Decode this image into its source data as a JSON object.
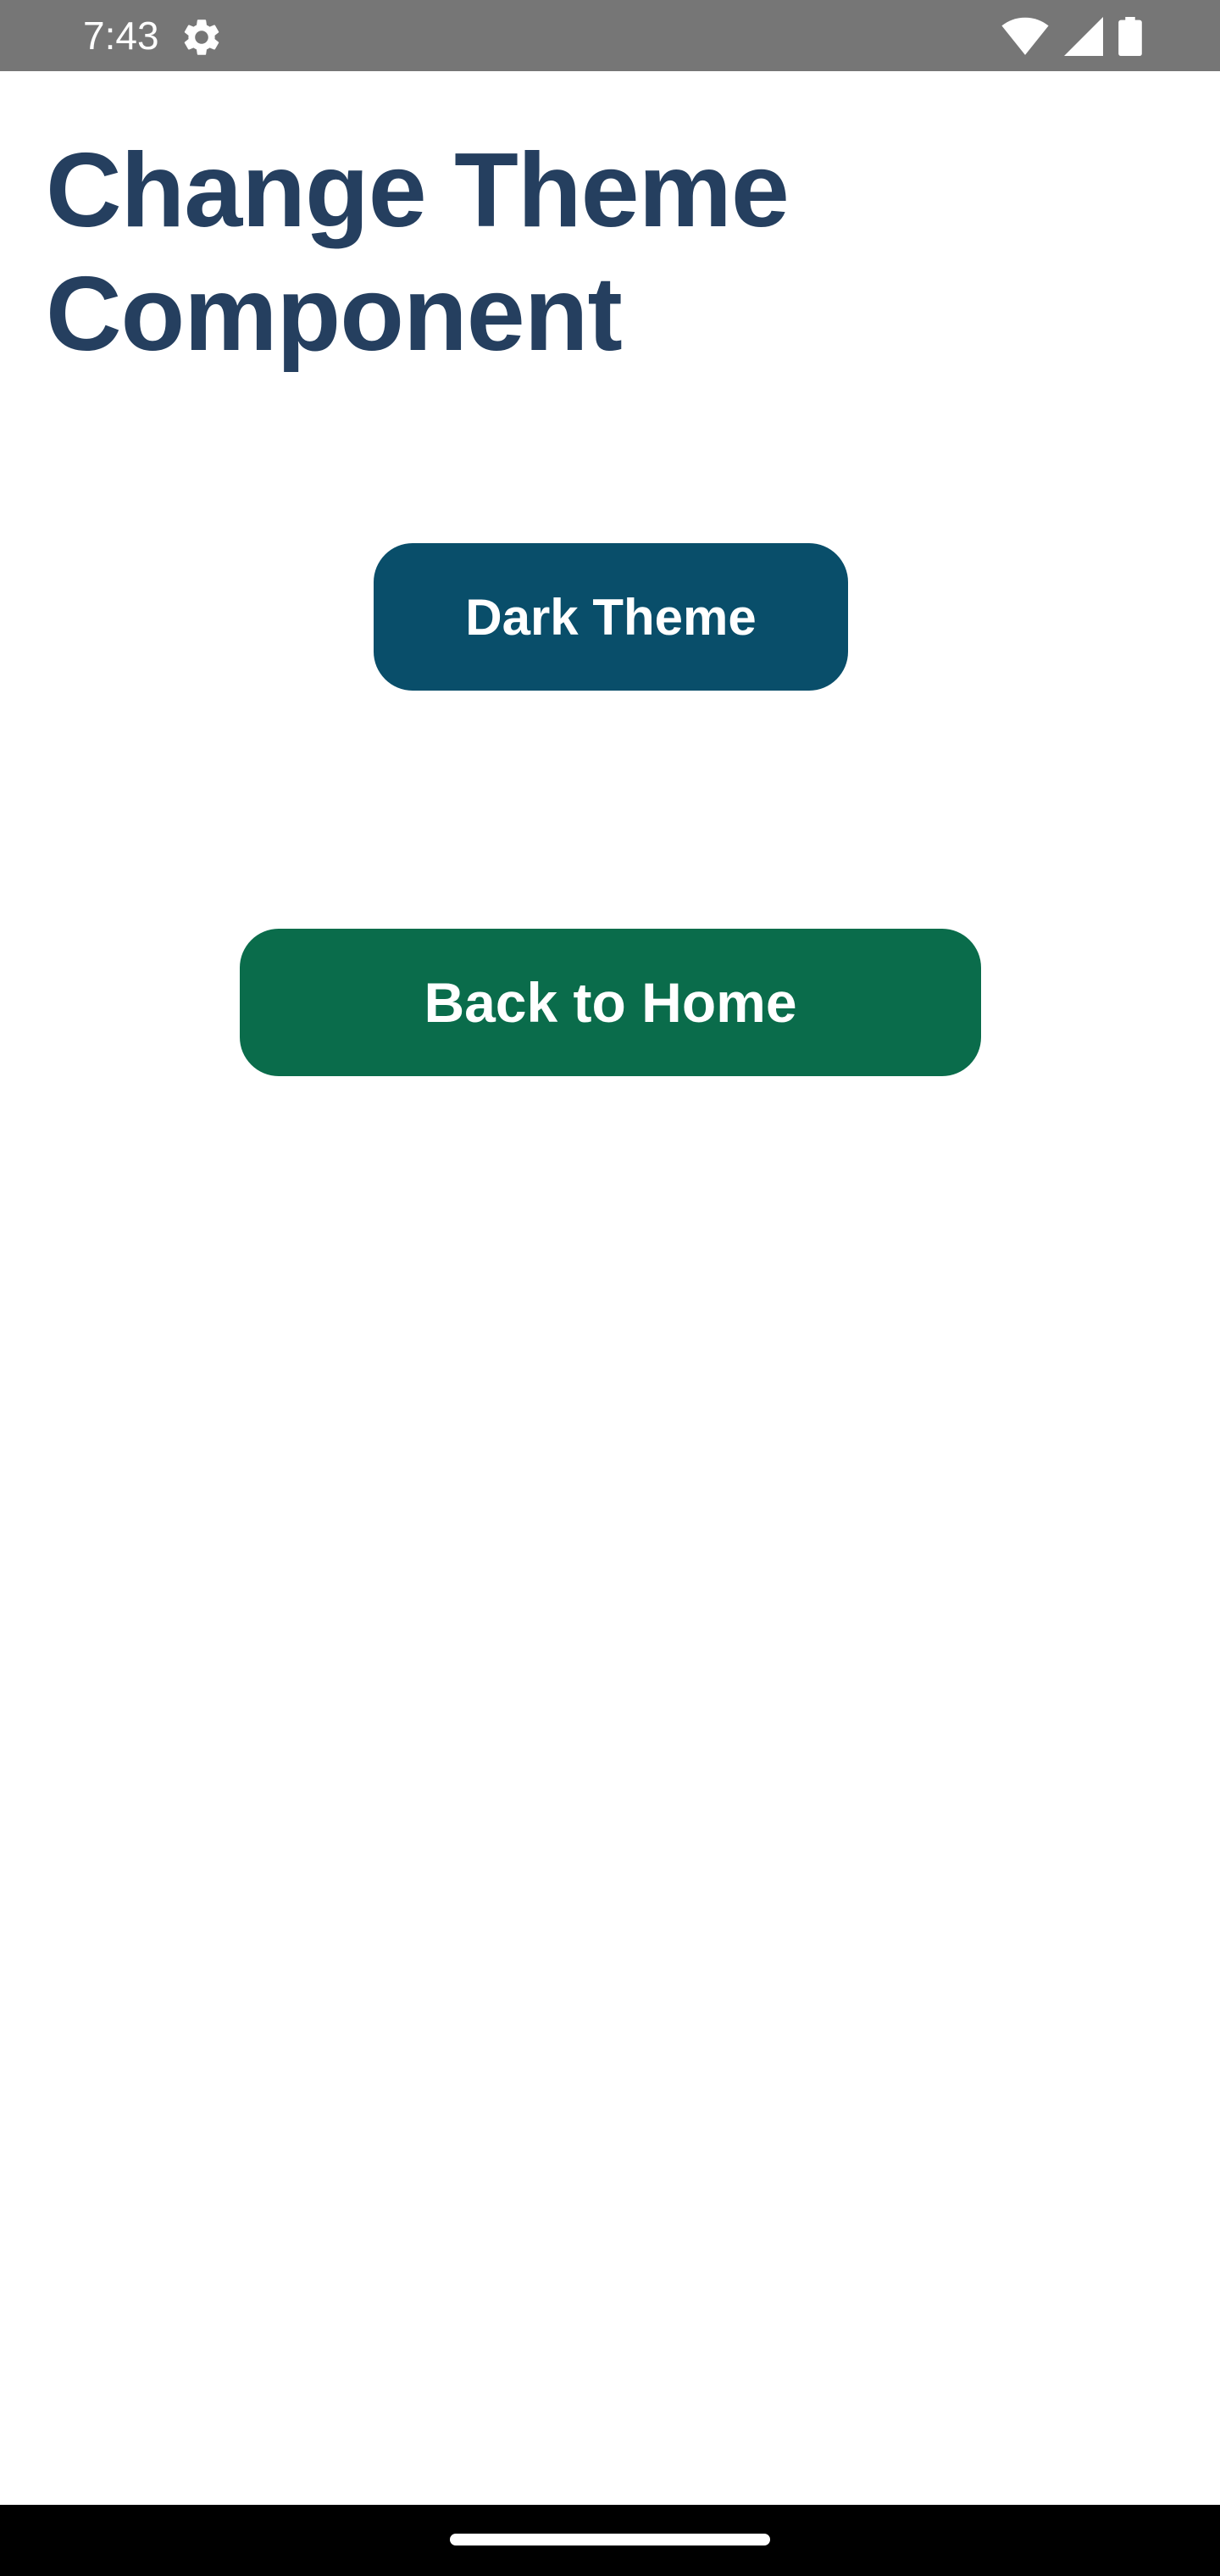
{
  "status_bar": {
    "time": "7:43",
    "icons": [
      "settings-gear-icon",
      "wifi-icon",
      "cellular-signal-icon",
      "battery-icon"
    ],
    "background_color": "#767676"
  },
  "page": {
    "title": "Change Theme Component",
    "title_color": "#253f5f"
  },
  "buttons": {
    "dark_theme_label": "Dark Theme",
    "dark_theme_color": "#094e6a",
    "back_home_label": "Back to Home",
    "back_home_color": "#0a6c4b"
  },
  "nav_bar": {
    "icons": [
      "home-indicator"
    ]
  }
}
